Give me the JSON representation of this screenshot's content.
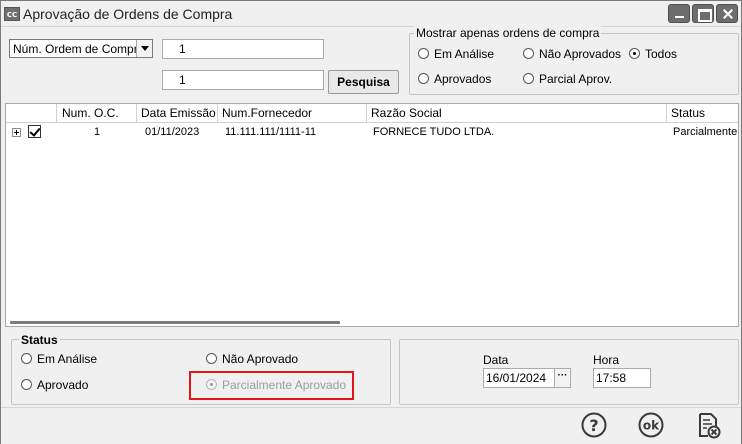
{
  "window": {
    "app_icon_text": "CC",
    "title": "Aprovação de Ordens de Compra"
  },
  "search": {
    "field_select": "Núm. Ordem de Compra",
    "from_value": "1",
    "to_value": "1",
    "search_button": "Pesquisa"
  },
  "filter": {
    "legend": "Mostrar apenas ordens de compra",
    "options": [
      {
        "label": "Em Análise",
        "selected": false
      },
      {
        "label": "Não Aprovados",
        "selected": false
      },
      {
        "label": "Todos",
        "selected": true
      },
      {
        "label": "Aprovados",
        "selected": false
      },
      {
        "label": "Parcial Aprov.",
        "selected": false
      }
    ]
  },
  "grid": {
    "columns": [
      "Num. O.C.",
      "Data Emissão",
      "Num.Fornecedor",
      "Razão Social",
      "Status"
    ],
    "rows": [
      {
        "checked": true,
        "num_oc": "1",
        "data_emissao": "01/11/2023",
        "num_fornecedor": "11.111.111/1111-11",
        "razao_social": "FORNECE TUDO LTDA.",
        "status": "Parcialmente A"
      }
    ]
  },
  "status": {
    "title": "Status",
    "options": [
      {
        "label": "Em Análise",
        "selected": false,
        "disabled": false
      },
      {
        "label": "Não Aprovado",
        "selected": false,
        "disabled": false
      },
      {
        "label": "Aprovado",
        "selected": false,
        "disabled": false
      },
      {
        "label": "Parcialmente Aprovado",
        "selected": true,
        "disabled": true
      }
    ]
  },
  "datetime": {
    "date_label": "Data",
    "date_value": "16/01/2024",
    "date_button": "···",
    "time_label": "Hora",
    "time_value": "17:58"
  },
  "footer": {
    "icons": [
      "help-icon",
      "ok-icon",
      "exit-icon"
    ],
    "ok_text": "ok",
    "help_text": "?"
  },
  "colors": {
    "highlight": "#e0161c",
    "window_bg": "#f0f0f0"
  }
}
